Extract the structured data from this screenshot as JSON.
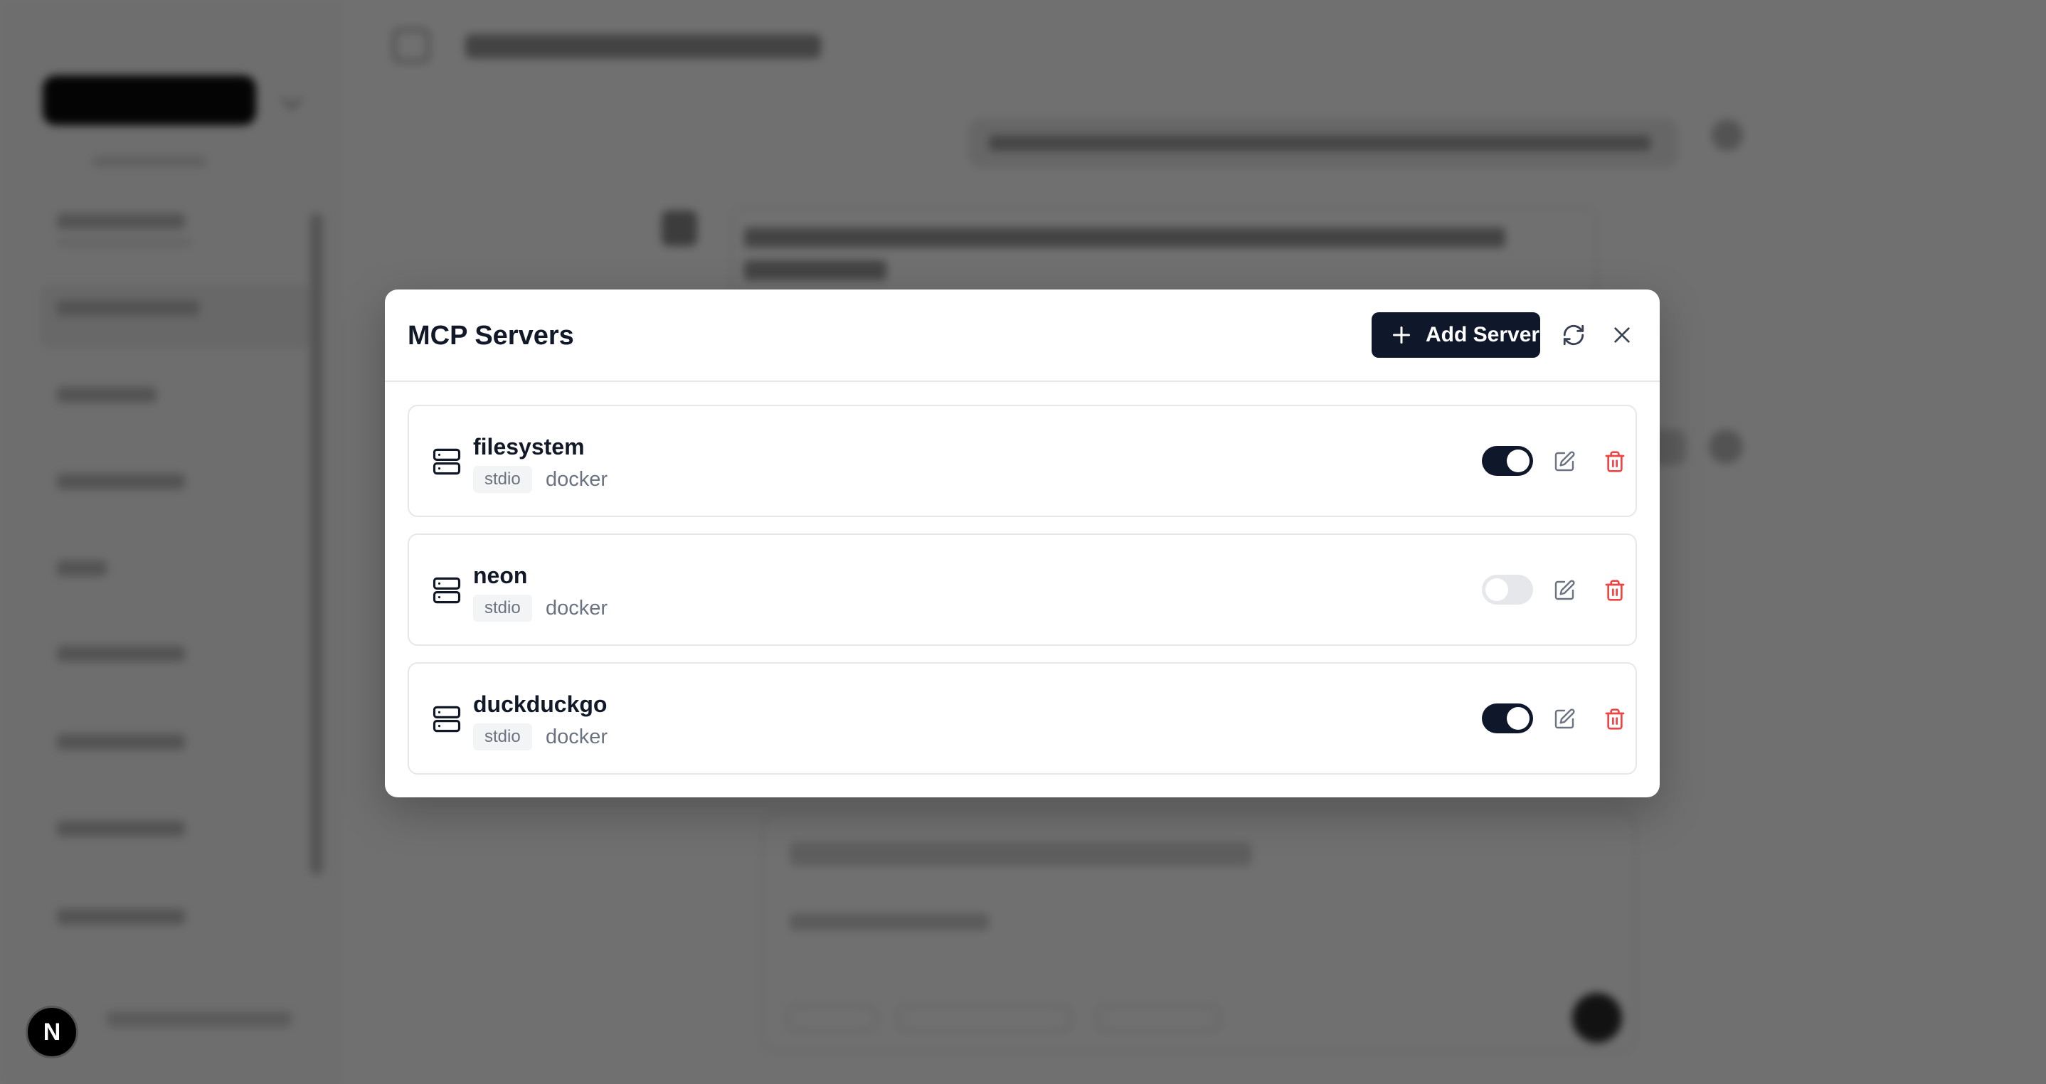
{
  "dialog": {
    "title": "MCP Servers",
    "add_button_label": "Add Server",
    "refresh_icon": "refresh-icon",
    "close_icon": "close-icon"
  },
  "servers": [
    {
      "name": "filesystem",
      "type": "stdio",
      "command": "docker",
      "enabled": true
    },
    {
      "name": "neon",
      "type": "stdio",
      "command": "docker",
      "enabled": false
    },
    {
      "name": "duckduckgo",
      "type": "stdio",
      "command": "docker",
      "enabled": true
    }
  ],
  "dev_badge": {
    "label": "N"
  },
  "colors": {
    "primary": "#0f172a",
    "danger": "#ef4444",
    "muted_text": "#6b7280",
    "border": "#e5e7eb",
    "overlay": "rgba(0,0,0,0.56)"
  }
}
